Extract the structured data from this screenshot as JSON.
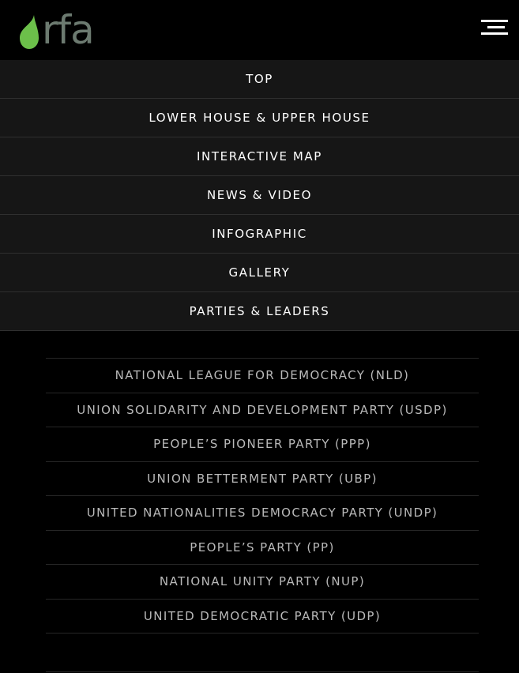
{
  "brand": {
    "logo_text": "rfa",
    "accent_color": "#6cc04a",
    "logo_text_color": "#6c7a70"
  },
  "header": {
    "menu_icon": "hamburger-menu-icon"
  },
  "nav": {
    "items": [
      {
        "label": "TOP"
      },
      {
        "label": "LOWER HOUSE & UPPER HOUSE"
      },
      {
        "label": "INTERACTIVE MAP"
      },
      {
        "label": "NEWS & VIDEO"
      },
      {
        "label": "INFOGRAPHIC"
      },
      {
        "label": "GALLERY"
      },
      {
        "label": "PARTIES & LEADERS"
      }
    ]
  },
  "parties": {
    "items": [
      {
        "label": "NATIONAL LEAGUE FOR DEMOCRACY (NLD)"
      },
      {
        "label": "UNION SOLIDARITY AND DEVELOPMENT PARTY (USDP)"
      },
      {
        "label": "PEOPLE’S PIONEER PARTY (PPP)"
      },
      {
        "label": "UNION BETTERMENT PARTY (UBP)"
      },
      {
        "label": "UNITED NATIONALITIES DEMOCRACY PARTY (UNDP)"
      },
      {
        "label": "PEOPLE’S PARTY (PP)"
      },
      {
        "label": "NATIONAL UNITY PARTY (NUP)"
      },
      {
        "label": "UNITED DEMOCRATIC PARTY (UDP)"
      }
    ]
  }
}
